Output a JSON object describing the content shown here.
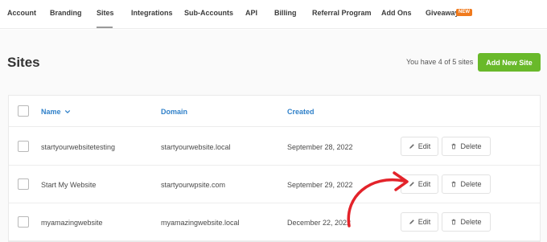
{
  "nav": {
    "items": [
      {
        "label": "Account"
      },
      {
        "label": "Branding"
      },
      {
        "label": "Sites"
      },
      {
        "label": "Integrations"
      },
      {
        "label": "Sub-Accounts"
      },
      {
        "label": "API"
      },
      {
        "label": "Billing"
      },
      {
        "label": "Referral Program"
      },
      {
        "label": "Add Ons"
      },
      {
        "label": "Giveaway"
      }
    ],
    "active": "Sites",
    "new_badge": "NEW"
  },
  "page": {
    "title": "Sites",
    "site_count_text": "You have 4 of 5 sites",
    "add_button_label": "Add New Site"
  },
  "table": {
    "columns": {
      "name": "Name",
      "domain": "Domain",
      "created": "Created"
    },
    "rows": [
      {
        "name": "startyourwebsitetesting",
        "domain": "startyourwebsite.local",
        "created": "September 28, 2022",
        "edit": "Edit",
        "delete": "Delete"
      },
      {
        "name": "Start My Website",
        "domain": "startyourwpsite.com",
        "created": "September 29, 2022",
        "edit": "Edit",
        "delete": "Delete"
      },
      {
        "name": "myamazingwebsite",
        "domain": "myamazingwebsite.local",
        "created": "December 22, 2022",
        "edit": "Edit",
        "delete": "Delete"
      }
    ]
  },
  "colors": {
    "accent_blue": "#2f80c9",
    "add_button_green": "#69b92a",
    "badge_orange": "#f07a1d",
    "annotation_red": "#e3232a"
  },
  "icons": {
    "sort": "chevron-down-icon",
    "edit": "pencil-icon",
    "delete": "trash-icon"
  }
}
